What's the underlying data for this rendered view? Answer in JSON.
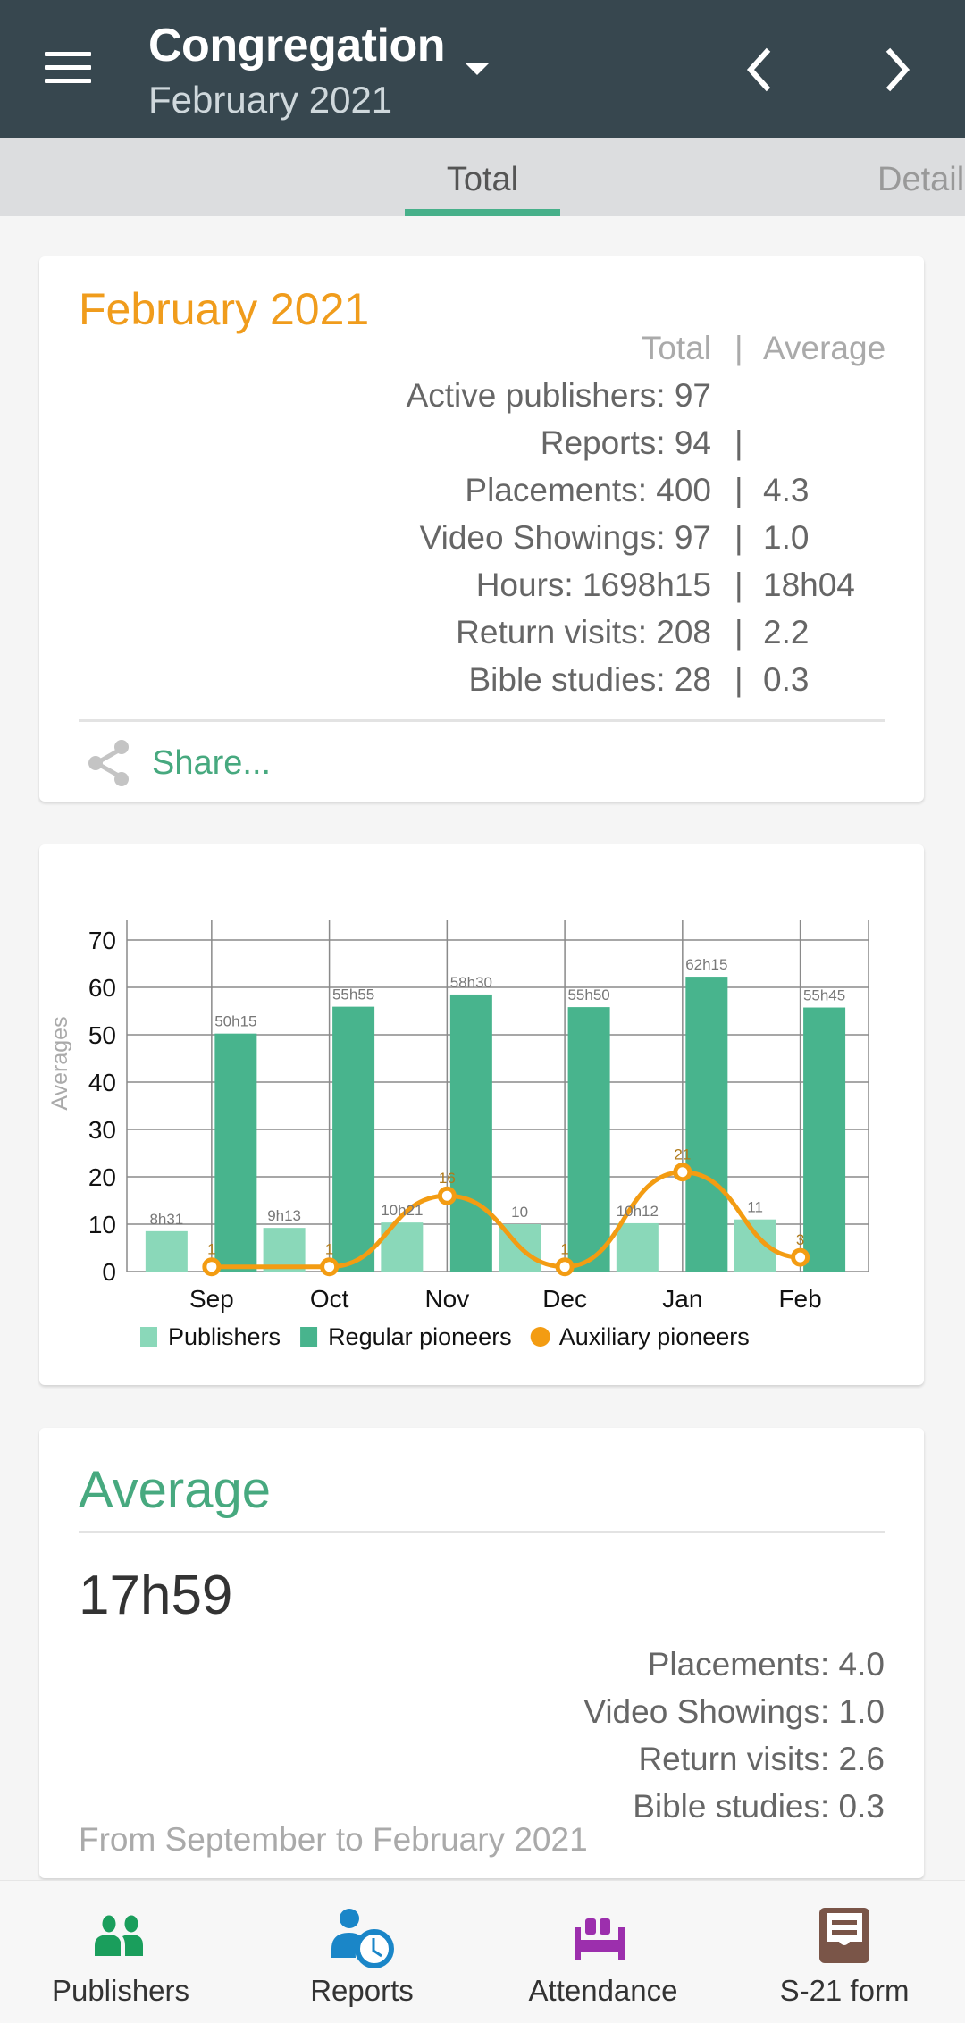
{
  "header": {
    "title": "Congregation",
    "subtitle": "February 2021"
  },
  "tabs": [
    {
      "label": "Total",
      "active": true
    },
    {
      "label": "Detail",
      "active": false
    }
  ],
  "month_card": {
    "title": "February 2021",
    "column_header_total": "Total",
    "column_header_sep": "|",
    "column_header_average": "Average",
    "rows": [
      {
        "label": "Active publishers: 97",
        "sep": "",
        "average": ""
      },
      {
        "label": "Reports: 94",
        "sep": "|",
        "average": ""
      },
      {
        "label": "Placements: 400",
        "sep": "|",
        "average": "4.3"
      },
      {
        "label": "Video Showings: 97",
        "sep": "|",
        "average": "1.0"
      },
      {
        "label": "Hours: 1698h15",
        "sep": "|",
        "average": "18h04"
      },
      {
        "label": "Return visits: 208",
        "sep": "|",
        "average": "2.2"
      },
      {
        "label": "Bible studies: 28",
        "sep": "|",
        "average": "0.3"
      }
    ],
    "share_label": "Share..."
  },
  "chart_data": {
    "type": "bar",
    "title": "",
    "xlabel": "",
    "ylabel": "Averages",
    "ylim": [
      0,
      70
    ],
    "yticks": [
      0,
      10,
      20,
      30,
      40,
      50,
      60,
      70
    ],
    "grid": true,
    "legend_position": "bottom",
    "categories": [
      "Sep",
      "Oct",
      "Nov",
      "Dec",
      "Jan",
      "Feb"
    ],
    "series": [
      {
        "name": "Publishers",
        "type": "bar",
        "color": "#8ad8b9",
        "values": [
          8.52,
          9.22,
          10.35,
          10.0,
          10.2,
          11.0
        ],
        "labels": [
          "8h31",
          "9h13",
          "10h21",
          "10",
          "10h12",
          "11"
        ]
      },
      {
        "name": "Regular pioneers",
        "type": "bar",
        "color": "#48b48d",
        "values": [
          50.25,
          55.92,
          58.5,
          55.83,
          62.25,
          55.75
        ],
        "labels": [
          "50h15",
          "55h55",
          "58h30",
          "55h50",
          "62h15",
          "55h45"
        ]
      },
      {
        "name": "Auxiliary pioneers",
        "type": "line",
        "color": "#f39c12",
        "values": [
          1,
          1,
          16,
          1,
          21,
          3
        ],
        "labels": [
          "1",
          "1",
          "16",
          "1",
          "21",
          "3"
        ]
      }
    ]
  },
  "average_card": {
    "title": "Average",
    "hours": "17h59",
    "items": [
      "Placements: 4.0",
      "Video Showings: 1.0",
      "Return visits: 2.6",
      "Bible studies: 0.3"
    ],
    "range": "From September to February 2021"
  },
  "bottom_nav": [
    {
      "label": "Publishers",
      "icon": "people-icon",
      "color": "#1a9e5c"
    },
    {
      "label": "Reports",
      "icon": "person-clock-icon",
      "color": "#1a86c8"
    },
    {
      "label": "Attendance",
      "icon": "seat-icon",
      "color": "#9c2fad"
    },
    {
      "label": "S-21 form",
      "icon": "form-card-icon",
      "color": "#7a5548"
    }
  ]
}
